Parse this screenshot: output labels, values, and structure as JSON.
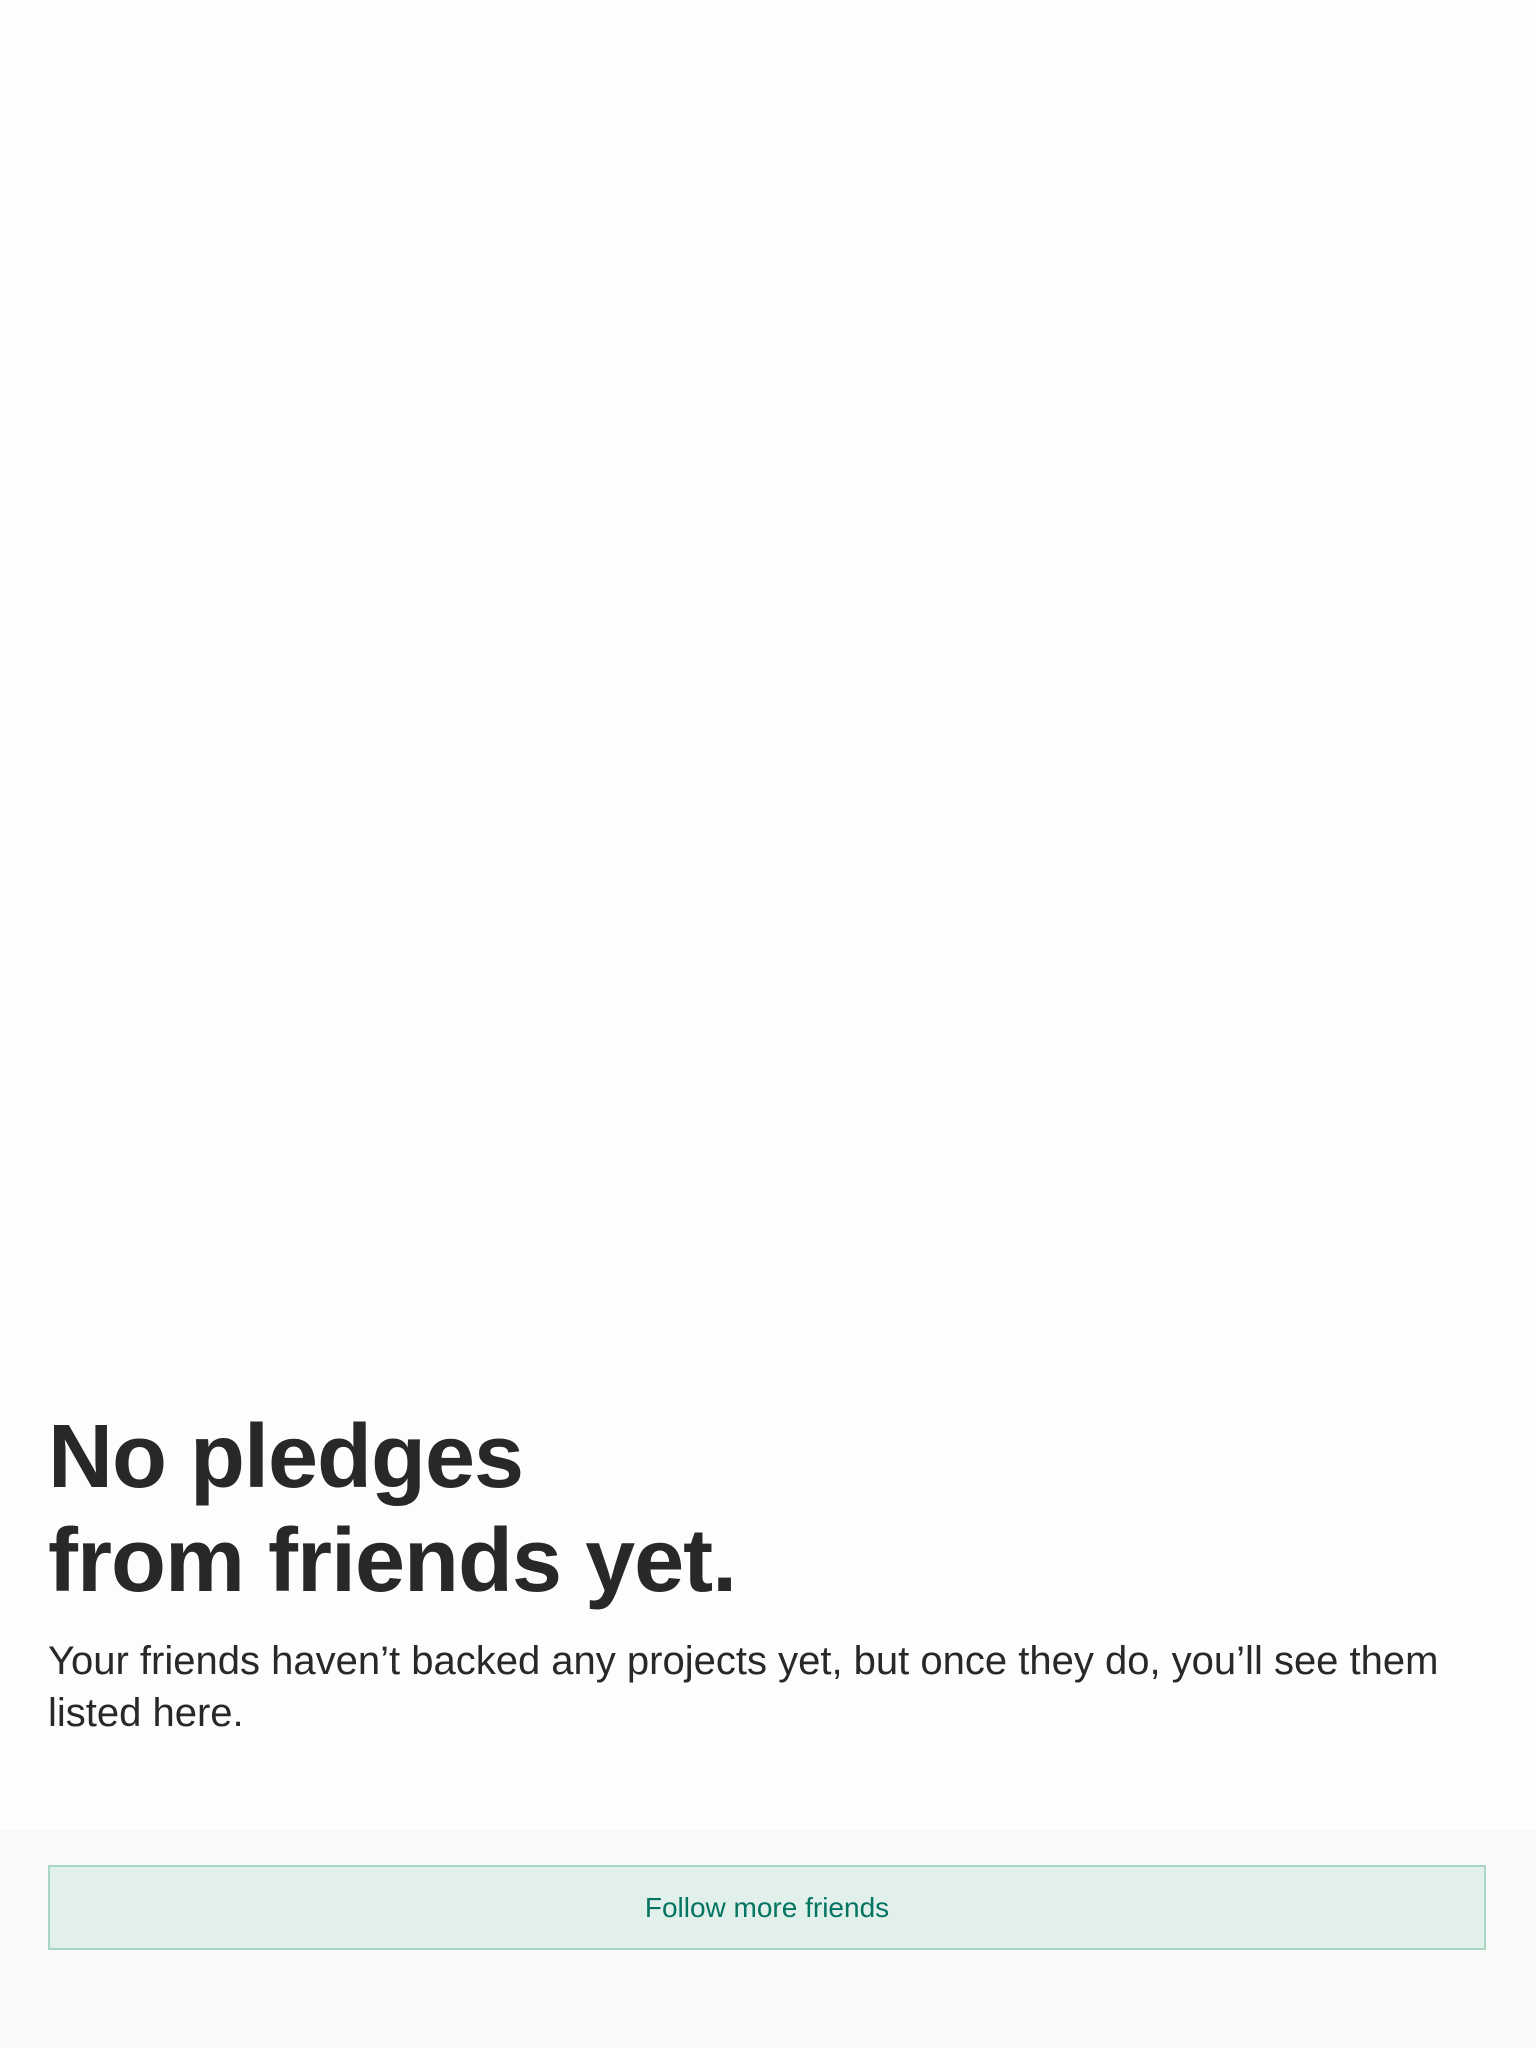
{
  "empty_state": {
    "title_line_1": "No pledges",
    "title_line_2": "from friends yet.",
    "description": "Your friends haven’t backed any projects yet, but once they do, you’ll see them listed here."
  },
  "actions": {
    "follow_label": "Follow more friends"
  },
  "colors": {
    "background": "#fdfdfd",
    "footer_background": "#f9f9f8",
    "text": "#282828",
    "button_background": "#e1f0ea",
    "button_border": "#a9d6c3",
    "button_text": "#037362"
  }
}
